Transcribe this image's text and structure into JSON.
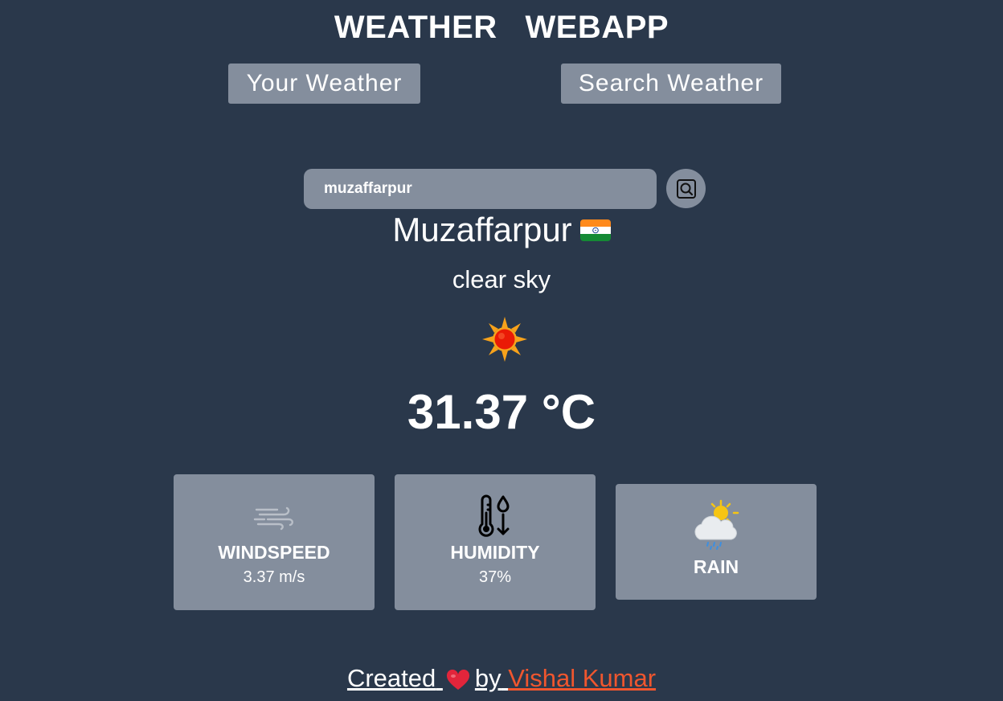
{
  "header": {
    "title": "WEATHER   WEBAPP"
  },
  "nav": {
    "your_weather": "Your Weather",
    "search_weather": "Search Weather"
  },
  "search": {
    "value": "muzaffarpur",
    "icon": "search-icon"
  },
  "weather": {
    "city": "Muzaffarpur",
    "flag": "india-flag-icon",
    "description": "clear sky",
    "icon": "sun-icon",
    "temperature": "31.37 °C"
  },
  "cards": {
    "windspeed": {
      "label": "WINDSPEED",
      "value": "3.37 m/s",
      "icon": "wind-icon"
    },
    "humidity": {
      "label": "HUMIDITY",
      "value": "37%",
      "icon": "thermometer-humidity-icon"
    },
    "rain": {
      "label": "RAIN",
      "icon": "sun-cloud-rain-icon"
    }
  },
  "footer": {
    "created": "Created",
    "by": "by",
    "author": "Vishal Kumar",
    "heart_icon": "heart-icon"
  },
  "colors": {
    "background": "#2a384b",
    "card": "#848e9d",
    "author_link": "#f0562e"
  }
}
